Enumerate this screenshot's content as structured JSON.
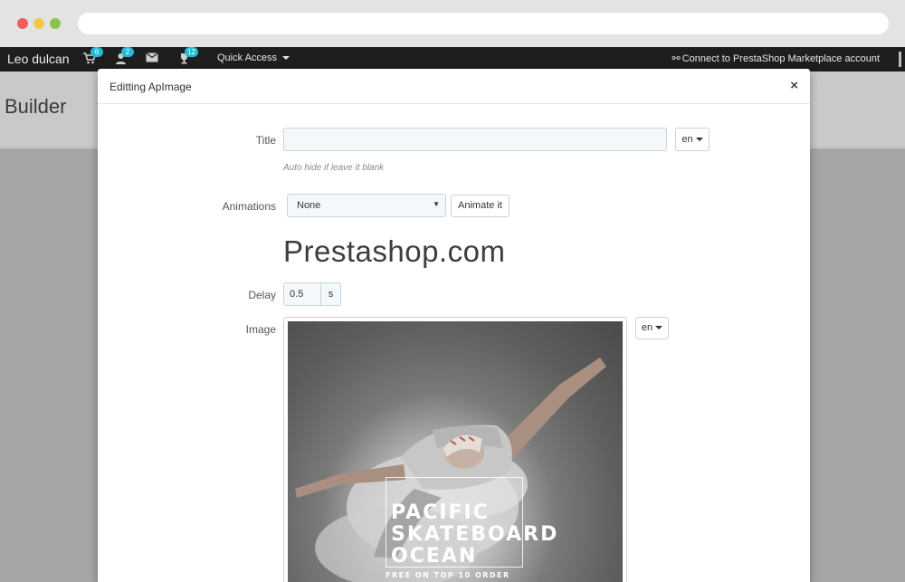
{
  "topbar": {
    "shop_name": "Leo dulcan",
    "cart_badge": "6",
    "customers_badge": "2",
    "messages_badge": "12",
    "quick_access": "Quick Access",
    "connect": "Connect to PrestaShop Marketplace account"
  },
  "page": {
    "title": "Builder"
  },
  "modal": {
    "title": "Editting ApImage",
    "close": "×",
    "title_label": "Title",
    "title_value": "",
    "title_lang": "en",
    "title_help": "Auto hide if leave it blank",
    "animations_label": "Animations",
    "animation_value": "None",
    "animate_button": "Animate it",
    "preview_text": "Prestashop.com",
    "delay_label": "Delay",
    "delay_value": "0.5",
    "delay_unit": "s",
    "image_label": "Image",
    "image_lang": "en",
    "poster": {
      "line1": "PACIFIC",
      "line2": "SKATEBOARD",
      "line3": "OCEAN",
      "sub": "FREE ON TOP 10 ORDER"
    }
  },
  "colors": {
    "badge": "#25b9d7",
    "adminbar": "#1e1e1e"
  }
}
